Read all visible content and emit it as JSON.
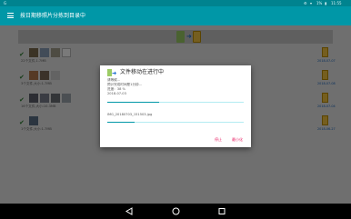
{
  "status_bar": {
    "left_label": "G",
    "signal_badge": "1%",
    "time": "11:55",
    "icons": [
      "android-debug-icon",
      "wifi-icon",
      "battery-icon"
    ]
  },
  "app_bar": {
    "title": "按日期移照片分拣到目录中",
    "menu_icon": "hamburger-menu-icon"
  },
  "folders": [
    {
      "label": "22个文件,1.7MB",
      "date": "2018-07-07",
      "thumb_colors": [
        "#7c6b4e",
        "#8aa0b8",
        "#a3a08d",
        "#ffffff"
      ]
    },
    {
      "label": "3个文件,大小:1.7MB",
      "date": "2018-07-08",
      "thumb_colors": [
        "#b57a4f",
        "#7b6a56",
        "#cfcfcf"
      ]
    },
    {
      "label": "16个文件,大小:10.3MB",
      "date": "2018-07-04",
      "thumb_colors": [
        "#5d5f6b",
        "#7a7e8c",
        "#6b6f76",
        "#9ea6ad"
      ]
    },
    {
      "label": "1个文件,大小:1.7MB",
      "date": "2018-06-27",
      "thumb_colors": [
        "#5b6f86"
      ]
    }
  ],
  "dialog": {
    "title": "文件移动在进行中",
    "line1": "请等候...",
    "line2": "预计完成时间是1分钟...",
    "progress_text": "进度：38 %",
    "current_folder": "2018-07-03",
    "progress1": 0.38,
    "current_file": "IMG_20180703_151503.jpg",
    "progress2": 0.2,
    "pause_button": "停止",
    "minimize_button": "最小化"
  },
  "colors": {
    "accent": "#0097a7",
    "status_bar": "#00838f",
    "button_text": "#e91e63",
    "folder": "#f4c542"
  },
  "nav_bar": [
    "back-icon",
    "home-icon",
    "recents-icon"
  ]
}
